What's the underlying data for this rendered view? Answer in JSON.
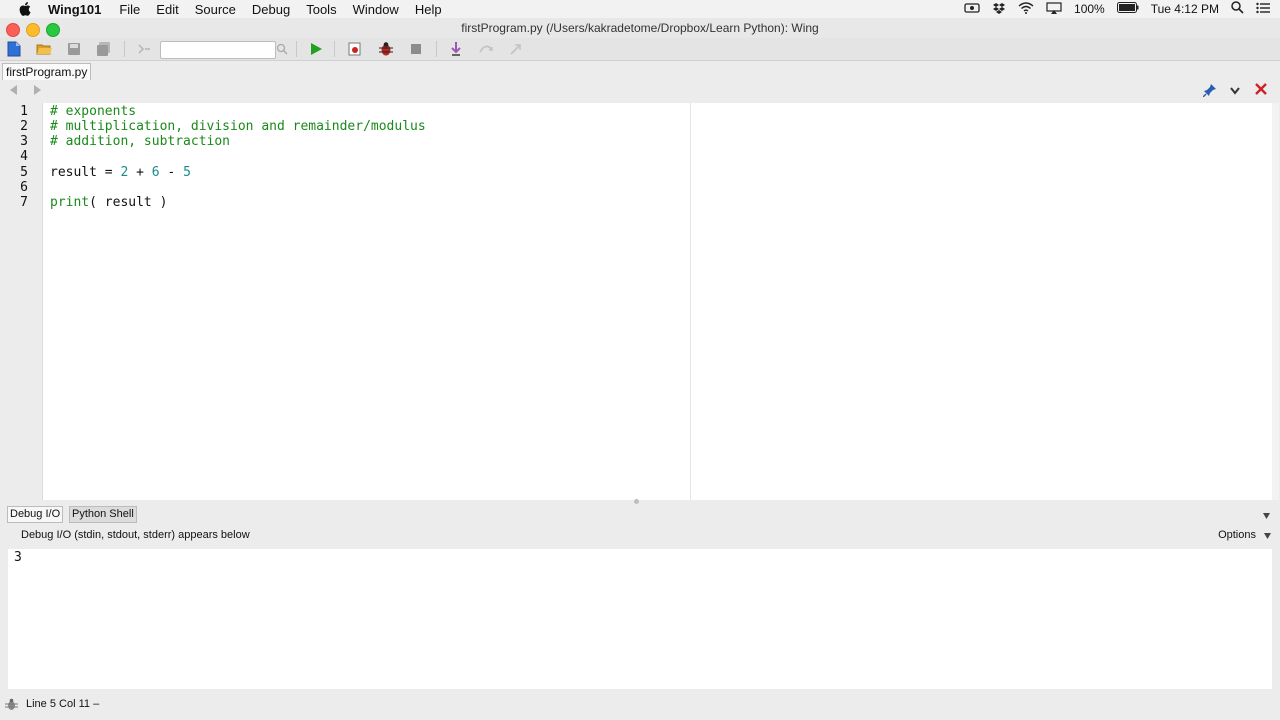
{
  "menubar": {
    "app_name": "Wing101",
    "items": [
      "File",
      "Edit",
      "Source",
      "Debug",
      "Tools",
      "Window",
      "Help"
    ],
    "battery": "100%",
    "clock": "Tue 4:12 PM"
  },
  "window": {
    "title": "firstProgram.py (/Users/kakradetome/Dropbox/Learn Python): Wing"
  },
  "toolbar": {
    "search_value": ""
  },
  "editor": {
    "file_tab": "firstProgram.py",
    "line_numbers": [
      "1",
      "2",
      "3",
      "4",
      "5",
      "6",
      "7"
    ],
    "lines": [
      {
        "parts": [
          {
            "t": "# exponents",
            "c": "cm"
          }
        ]
      },
      {
        "parts": [
          {
            "t": "# multiplication, division and remainder/modulus",
            "c": "cm"
          }
        ]
      },
      {
        "parts": [
          {
            "t": "# addition, subtraction",
            "c": "cm"
          }
        ]
      },
      {
        "parts": []
      },
      {
        "parts": [
          {
            "t": "result = ",
            "c": "kw"
          },
          {
            "t": "2",
            "c": "num"
          },
          {
            "t": " ",
            "c": "kw"
          },
          {
            "t": "+",
            "c": "kw"
          },
          {
            "t": " ",
            "c": "kw"
          },
          {
            "t": "6",
            "c": "num"
          },
          {
            "t": " - ",
            "c": "kw"
          },
          {
            "t": "5",
            "c": "num"
          }
        ]
      },
      {
        "parts": []
      },
      {
        "parts": [
          {
            "t": "print",
            "c": "cm"
          },
          {
            "t": "( result )",
            "c": "kw"
          }
        ]
      }
    ]
  },
  "bottom_panel": {
    "tabs": [
      "Debug I/O",
      "Python Shell"
    ],
    "header": "Debug I/O (stdin, stdout, stderr) appears below",
    "options_label": "Options",
    "output": "3"
  },
  "status": {
    "text": "Line 5 Col 11 –"
  },
  "colors": {
    "comment": "#1a8a1a",
    "number": "#1b8a8a",
    "run": "#22a022",
    "close_red": "#cc2222"
  }
}
